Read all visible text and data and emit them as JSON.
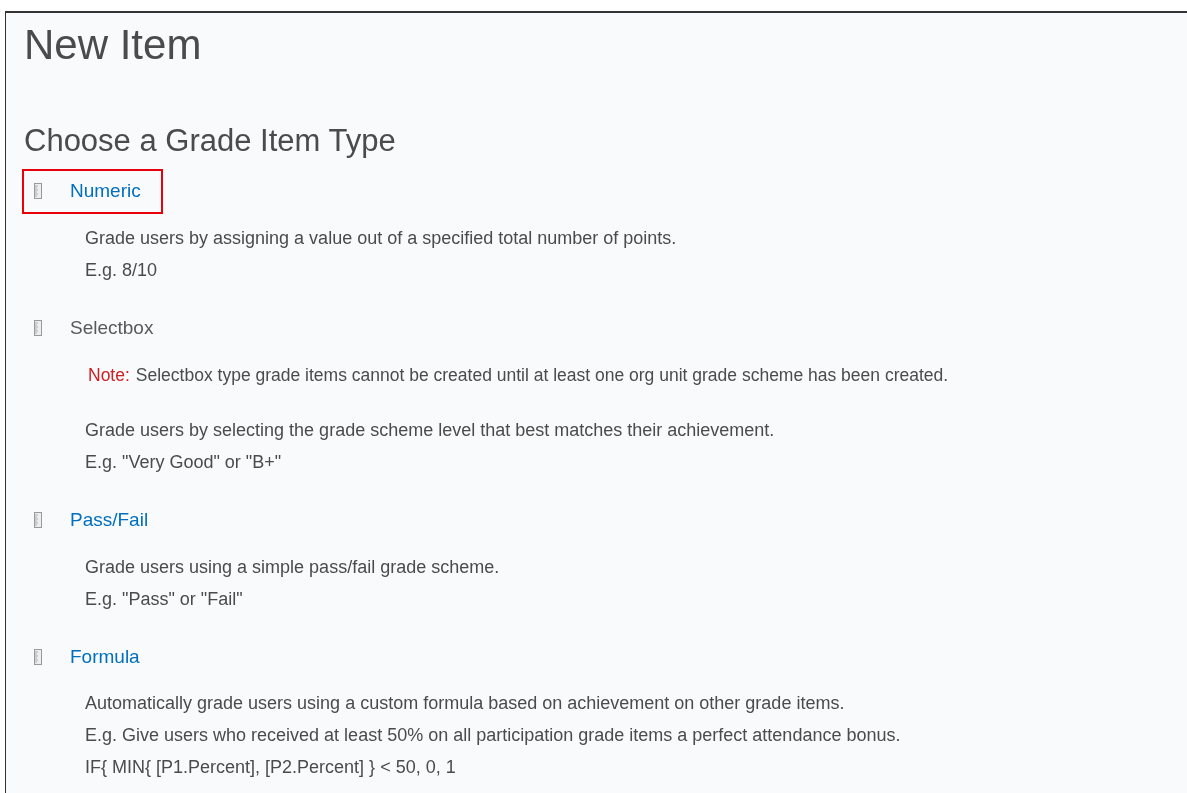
{
  "page": {
    "title": "New Item"
  },
  "section": {
    "heading": "Choose a Grade Item Type"
  },
  "items": [
    {
      "name": "Numeric",
      "disabled": false,
      "highlighted": true,
      "description": [
        "Grade users by assigning a value out of a specified total number of points.",
        "E.g. 8/10"
      ]
    },
    {
      "name": "Selectbox",
      "disabled": true,
      "highlighted": false,
      "note": {
        "label": "Note:",
        "text": "Selectbox type grade items cannot be created until at least one org unit grade scheme has been created."
      },
      "description": [
        "Grade users by selecting the grade scheme level that best matches their achievement.",
        "E.g. \"Very Good\" or \"B+\""
      ]
    },
    {
      "name": "Pass/Fail",
      "disabled": false,
      "highlighted": false,
      "description": [
        "Grade users using a simple pass/fail grade scheme.",
        "E.g. \"Pass\" or \"Fail\""
      ]
    },
    {
      "name": "Formula",
      "disabled": false,
      "highlighted": false,
      "description": [
        "Automatically grade users using a custom formula based on achievement on other grade items.",
        "E.g. Give users who received at least 50% on all participation grade items a perfect attendance bonus.",
        "IF{ MIN{ [P1.Percent], [P2.Percent] } < 50, 0, 1"
      ]
    }
  ]
}
